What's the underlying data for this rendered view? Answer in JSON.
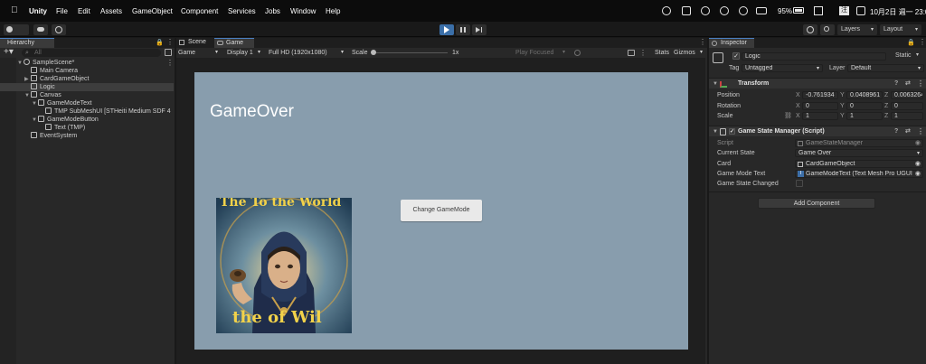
{
  "menubar": {
    "app": "Unity",
    "items": [
      "File",
      "Edit",
      "Assets",
      "GameObject",
      "Component",
      "Services",
      "Jobs",
      "Window",
      "Help"
    ],
    "battery": "95%",
    "clock": "10月2日 週一  23:01"
  },
  "toolbar": {
    "layers_label": "Layers",
    "layout_label": "Layout"
  },
  "hierarchy": {
    "tab": "Hierarchy",
    "search_placeholder": "All",
    "items": [
      {
        "label": "SampleScene*",
        "indent": 0,
        "selected": false
      },
      {
        "label": "Main Camera",
        "indent": 1,
        "selected": false
      },
      {
        "label": "CardGameObject",
        "indent": 1,
        "selected": false
      },
      {
        "label": "Logic",
        "indent": 1,
        "selected": true
      },
      {
        "label": "Canvas",
        "indent": 1,
        "selected": false
      },
      {
        "label": "GameModeText",
        "indent": 2,
        "selected": false
      },
      {
        "label": "TMP SubMeshUI [STHeiti Medium SDF 4",
        "indent": 3,
        "selected": false
      },
      {
        "label": "GameModeButton",
        "indent": 2,
        "selected": false
      },
      {
        "label": "Text (TMP)",
        "indent": 3,
        "selected": false
      },
      {
        "label": "EventSystem",
        "indent": 1,
        "selected": false
      }
    ]
  },
  "game_view": {
    "tabs": [
      "Scene",
      "Game"
    ],
    "mode": "Game",
    "display": "Display 1",
    "resolution": "Full HD (1920x1080)",
    "scale_label": "Scale",
    "scale_value": "1x",
    "play_focused": "Play Focused",
    "stats": "Stats",
    "gizmos": "Gizmos",
    "title_text": "GameOver",
    "button_label": "Change GameMode",
    "poster_top_text": "The To the World",
    "poster_bottom_text": "the of Wil"
  },
  "inspector": {
    "tab": "Inspector",
    "object_name": "Logic",
    "static_label": "Static",
    "tag_label": "Tag",
    "tag_value": "Untagged",
    "layer_label": "Layer",
    "layer_value": "Default",
    "transform": {
      "title": "Transform",
      "position_label": "Position",
      "rotation_label": "Rotation",
      "scale_label": "Scale",
      "position": {
        "x": "-0.761934",
        "y": "0.0408961",
        "z": "0.0063264"
      },
      "rotation": {
        "x": "0",
        "y": "0",
        "z": "0"
      },
      "scale": {
        "x": "1",
        "y": "1",
        "z": "1"
      }
    },
    "script_component": {
      "title": "Game State Manager (Script)",
      "script_label": "Script",
      "script_value": "GameStateManager",
      "current_state_label": "Current State",
      "current_state_value": "Game Over",
      "card_label": "Card",
      "card_value": "CardGameObject",
      "game_mode_text_label": "Game Mode Text",
      "game_mode_text_value": "GameModeText (Text Mesh Pro UGUI",
      "game_state_changed_label": "Game State Changed"
    },
    "add_component": "Add Component"
  }
}
